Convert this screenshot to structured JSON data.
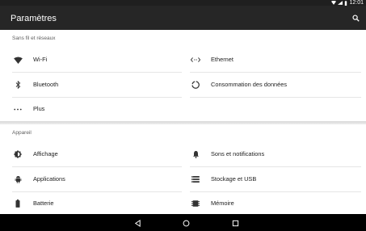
{
  "status_bar": {
    "time": "12:01",
    "icons": [
      "wifi-icon",
      "signal-icon",
      "battery-icon"
    ]
  },
  "app_bar": {
    "title": "Paramètres",
    "search_icon": "search-icon"
  },
  "sections": {
    "wireless": {
      "header": "Sans fil et réseaux",
      "items": {
        "wifi": {
          "label": "Wi-Fi",
          "icon": "wifi-icon"
        },
        "ethernet": {
          "label": "Ethernet",
          "icon": "ethernet-icon"
        },
        "bluetooth": {
          "label": "Bluetooth",
          "icon": "bluetooth-icon"
        },
        "data_usage": {
          "label": "Consommation des données",
          "icon": "data-usage-icon"
        },
        "more": {
          "label": "Plus",
          "icon": "more-icon"
        }
      }
    },
    "device": {
      "header": "Appareil",
      "items": {
        "display": {
          "label": "Affichage",
          "icon": "brightness-icon"
        },
        "sound": {
          "label": "Sons et notifications",
          "icon": "bell-icon"
        },
        "apps": {
          "label": "Applications",
          "icon": "android-icon"
        },
        "storage": {
          "label": "Stockage et USB",
          "icon": "storage-icon"
        },
        "battery": {
          "label": "Batterie",
          "icon": "battery-icon"
        },
        "memory": {
          "label": "Mémoire",
          "icon": "memory-icon"
        }
      }
    }
  },
  "nav_bar": {
    "back": "back-icon",
    "home": "home-icon",
    "recents": "recents-icon"
  }
}
